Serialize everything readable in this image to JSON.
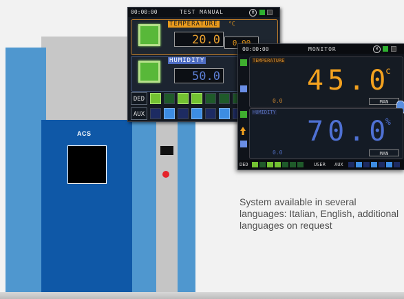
{
  "chamber": {
    "brand": "ACS"
  },
  "screen_back": {
    "time": "00:00:00",
    "title": "TEST MANUAL",
    "mode_icon": "M",
    "temperature": {
      "label": "TEMPERATURE",
      "unit": "°C",
      "value": "20.0",
      "setpoint": "0.00"
    },
    "humidity": {
      "label": "HUMIDITY",
      "value": "50.0"
    },
    "rows": [
      {
        "label": "DED"
      },
      {
        "label": "AUX"
      }
    ],
    "colors": {
      "temp": "#e89a1d",
      "hum": "#4d6cc2",
      "green": "#58b839"
    }
  },
  "screen_front": {
    "time": "00:00:00",
    "title": "MONITOR",
    "mode_icon": "M",
    "temperature": {
      "label": "TEMPERATURE",
      "value": "45.0",
      "unit": "c",
      "setpoint": "0.0",
      "mode": "MAN"
    },
    "humidity": {
      "label": "HUMIDITY",
      "value": "70.0",
      "unit": "%",
      "setpoint": "0.0",
      "mode": "MAN"
    },
    "bottom": {
      "ded": "DED",
      "user": "USER",
      "aux": "AUX"
    },
    "colors": {
      "temp": "#f4a21f",
      "hum": "#4f71d4"
    }
  },
  "caption": {
    "text": "System available in several languages: Italian, English, additional languages on request"
  }
}
